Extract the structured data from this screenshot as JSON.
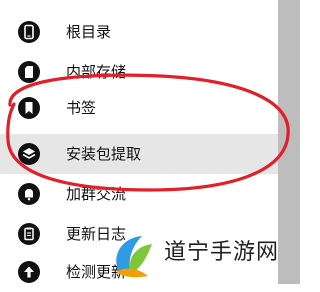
{
  "menu": {
    "items": [
      {
        "label": "根目录",
        "icon": "phone-icon"
      },
      {
        "label": "内部存储",
        "icon": "sd-card-icon"
      },
      {
        "label": "书签",
        "icon": "bookmark-icon"
      },
      {
        "label": "安装包提取",
        "icon": "layers-icon"
      },
      {
        "label": "加群交流",
        "icon": "bell-icon"
      },
      {
        "label": "更新日志",
        "icon": "clipboard-icon"
      },
      {
        "label": "检测更新",
        "icon": "arrow-up-icon"
      }
    ],
    "active_index": 3
  },
  "annotation": {
    "color": "#e0202a"
  },
  "watermark": {
    "text": "道宁手游网",
    "colors": [
      "#2e9be3",
      "#7cc63a",
      "#f2a007"
    ]
  }
}
